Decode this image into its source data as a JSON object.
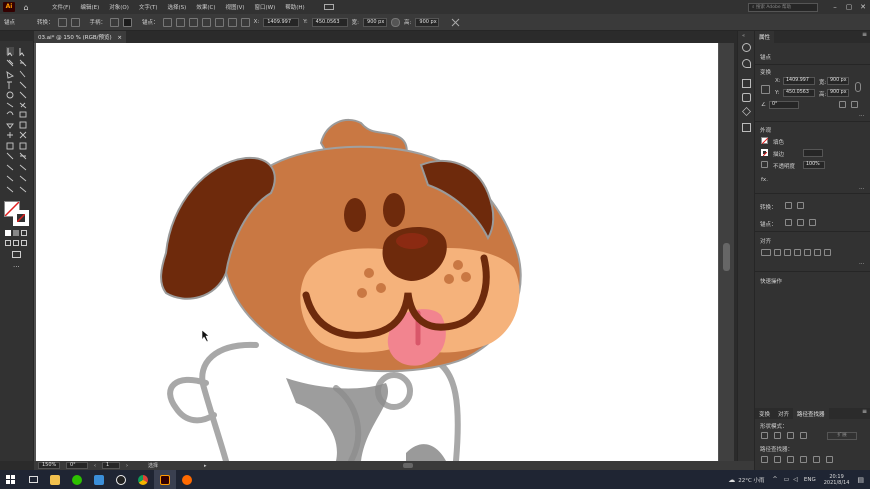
{
  "menubar": {
    "app_icon": "Ai",
    "items": [
      "文件(F)",
      "编辑(E)",
      "对象(O)",
      "文字(T)",
      "选择(S)",
      "效果(C)",
      "视图(V)",
      "窗口(W)",
      "帮助(H)"
    ],
    "search_placeholder": "搜索 Adobe 帮助"
  },
  "controlbar": {
    "label_anchor": "锚点",
    "label_convert": "转换：",
    "label_handle": "手柄：",
    "label_anchor2": "锚点：",
    "x_value": "1409.997",
    "y_value": "450.0563",
    "w_value": "900 px",
    "h_value": "900 px"
  },
  "document": {
    "tab_title": "03.ai* @ 150 % (RGB/预览)",
    "close_glyph": "×"
  },
  "statusbar": {
    "zoom": "150%",
    "rotation": "0°",
    "artboard": "1",
    "tool_name": "选择"
  },
  "panel": {
    "tabs": [
      "属性"
    ],
    "selection_label": "锚点",
    "transform_title": "变换",
    "x_label": "X:",
    "x_value": "1409.997",
    "y_label": "Y:",
    "y_value": "450.0563",
    "w_label": "宽:",
    "w_value": "900 px",
    "h_label": "高:",
    "h_value": "900 px",
    "angle_value": "0°",
    "appearance_title": "外观",
    "fill_label": "填色",
    "stroke_label": "描边",
    "opacity_label": "不透明度",
    "opacity_value": "100%",
    "fx_label": "fx.",
    "convert_label": "转换：",
    "anchor_label": "锚点：",
    "align_title": "对齐",
    "quick_actions_title": "快速操作",
    "bottom_tabs": [
      "变换",
      "对齐",
      "路径查找器"
    ],
    "shape_modes_label": "形状模式：",
    "expand_label": "扩展",
    "pathfinder_label": "路径查找器："
  },
  "taskbar": {
    "weather": "22°C 小雨",
    "lang": "ENG",
    "time": "20:19",
    "date": "2021/8/14"
  },
  "colors": {
    "dog_head": "#c97843",
    "dog_ear": "#6e2a0c",
    "dog_muzzle": "#f5b27b",
    "dog_tongue": "#f2848f",
    "accent": "#ff9a00"
  }
}
